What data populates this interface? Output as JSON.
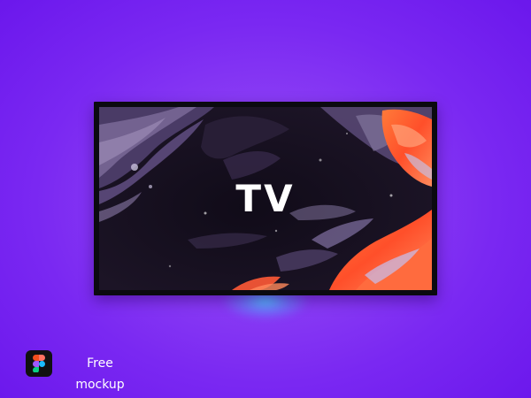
{
  "tv": {
    "screen_text": "TV"
  },
  "caption": {
    "line1": "Free",
    "line2": "mockup"
  },
  "icons": {
    "logo": "figma-logo-icon"
  },
  "colors": {
    "background": "#7a28f2",
    "glow": "#50c8ff",
    "screen_bezel": "#0b0a10",
    "screen_accent": "#ff5a36",
    "text": "#ffffff"
  }
}
